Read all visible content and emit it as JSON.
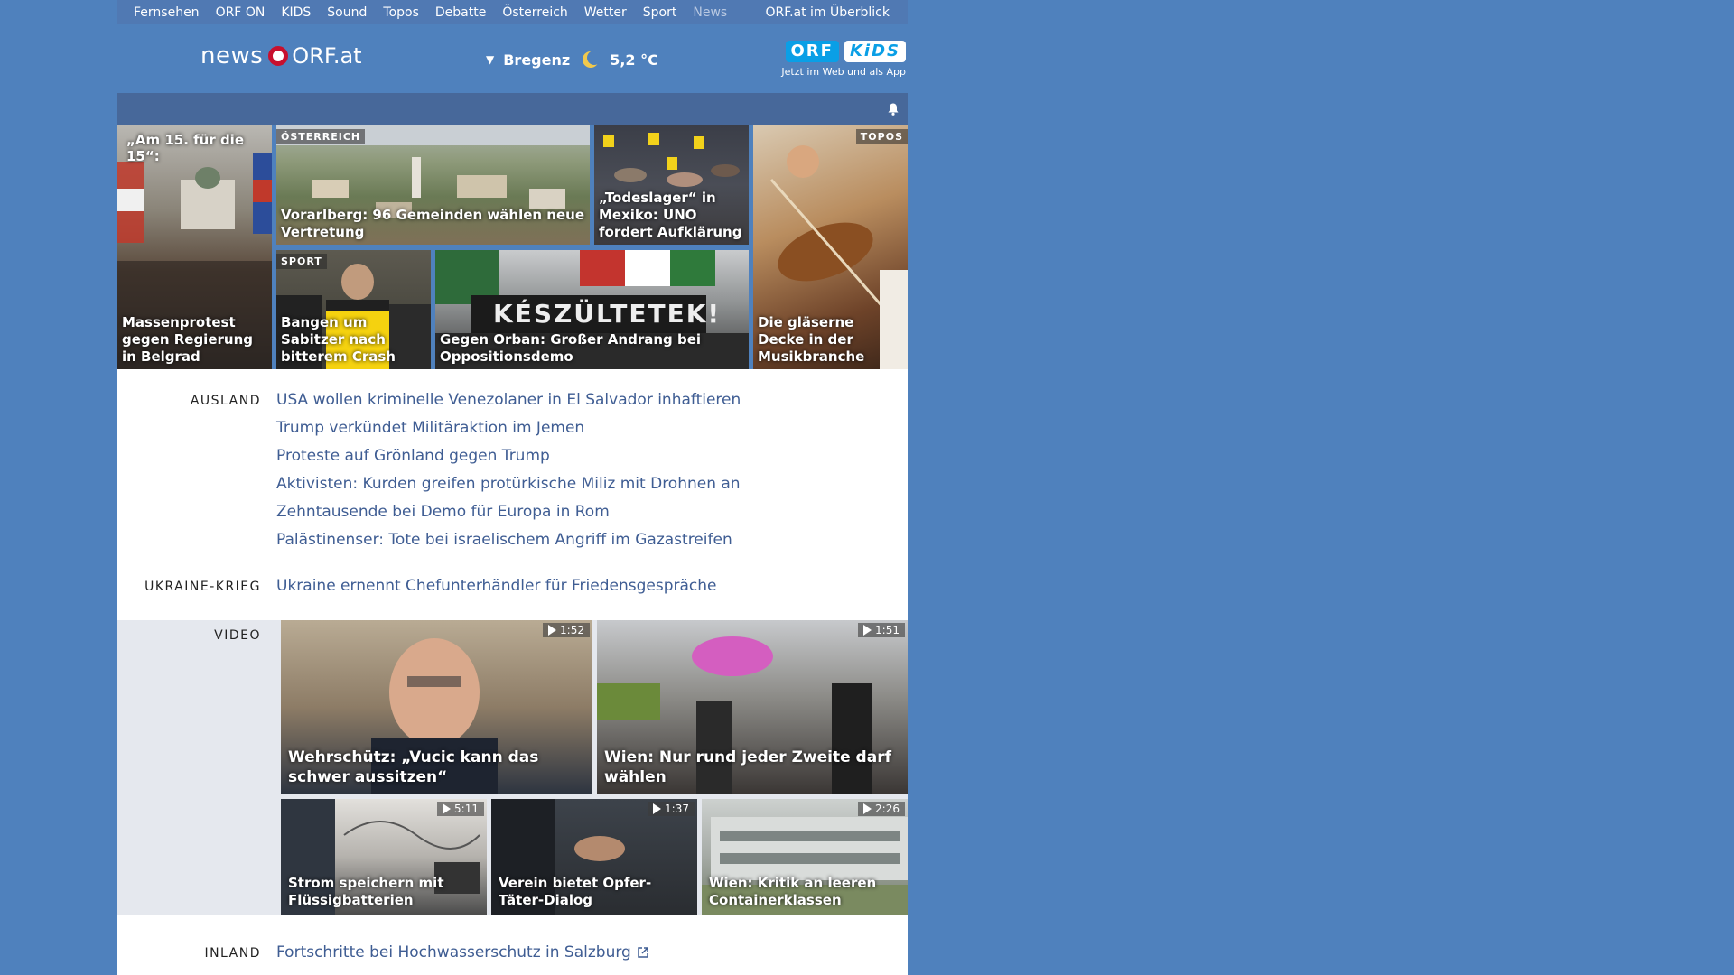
{
  "topnav": {
    "items": [
      "Fernsehen",
      "ORF ON",
      "KIDS",
      "Sound",
      "Topos",
      "Debatte",
      "Österreich",
      "Wetter",
      "Sport",
      "News"
    ],
    "overview": "ORF.at im Überblick"
  },
  "header": {
    "logo_news": "news",
    "logo_orf": "ORF.at",
    "weather": {
      "city": "Bregenz",
      "temp": "5,2 °C"
    },
    "kids": {
      "badge1": "ORF",
      "badge2": "KiDS",
      "subtitle": "Jetzt im Web und als App"
    }
  },
  "teasers": [
    {
      "toptext": "„Am 15. für die 15“:",
      "caption": "Massenprotest gegen Regierung in Belgrad"
    },
    {
      "tag": "ÖSTERREICH",
      "caption": "Vorarlberg: 96 Gemeinden wählen neue Vertretung"
    },
    {
      "caption": "„Todeslager“ in Mexiko: UNO fordert Aufklärung"
    },
    {
      "tag": "TOPOS",
      "caption": "Die gläserne Decke in der Musikbranche"
    },
    {
      "tag": "SPORT",
      "caption": "Bangen um Sabitzer nach bitterem Crash"
    },
    {
      "caption": "Gegen Orban: Großer Andrang bei Oppositionsdemo",
      "banner": "KÉSZÜLTETEK!"
    }
  ],
  "sections": {
    "ausland": {
      "label": "AUSLAND",
      "links": [
        "USA wollen kriminelle Venezolaner in El Salvador inhaftieren",
        "Trump verkündet Militäraktion im Jemen",
        "Proteste auf Grönland gegen Trump",
        "Aktivisten: Kurden greifen protürkische Miliz mit Drohnen an",
        "Zehntausende bei Demo für Europa in Rom",
        "Palästinenser: Tote bei israelischem Angriff im Gazastreifen"
      ]
    },
    "ukraine": {
      "label": "UKRAINE-KRIEG",
      "links": [
        "Ukraine ernennt Chefunterhändler für Friedensgespräche"
      ]
    },
    "video": {
      "label": "VIDEO",
      "items": [
        {
          "duration": "1:52",
          "caption": "Wehrschütz: „Vucic kann das schwer aussitzen“"
        },
        {
          "duration": "1:51",
          "caption": "Wien: Nur rund jeder Zweite darf wählen"
        },
        {
          "duration": "5:11",
          "caption": "Strom speichern mit Flüssigbatterien"
        },
        {
          "duration": "1:37",
          "caption": "Verein bietet Opfer-Täter-Dialog"
        },
        {
          "duration": "2:26",
          "caption": "Wien: Kritik an leeren Containerklassen"
        }
      ]
    },
    "inland": {
      "label": "INLAND",
      "links": [
        "Fortschritte bei Hochwasserschutz in Salzburg"
      ]
    }
  },
  "icons": {
    "bell": "bell-icon",
    "moon": "moon-icon",
    "play": "play-icon",
    "external": "external-link-icon"
  },
  "colors": {
    "page_bg": "#4f81bd",
    "topnav_bg": "#5079b3",
    "bar_bg": "#47689a",
    "link": "#3f5d93",
    "orf_red": "#c8102e",
    "kids_blue": "#0a9fe6"
  }
}
